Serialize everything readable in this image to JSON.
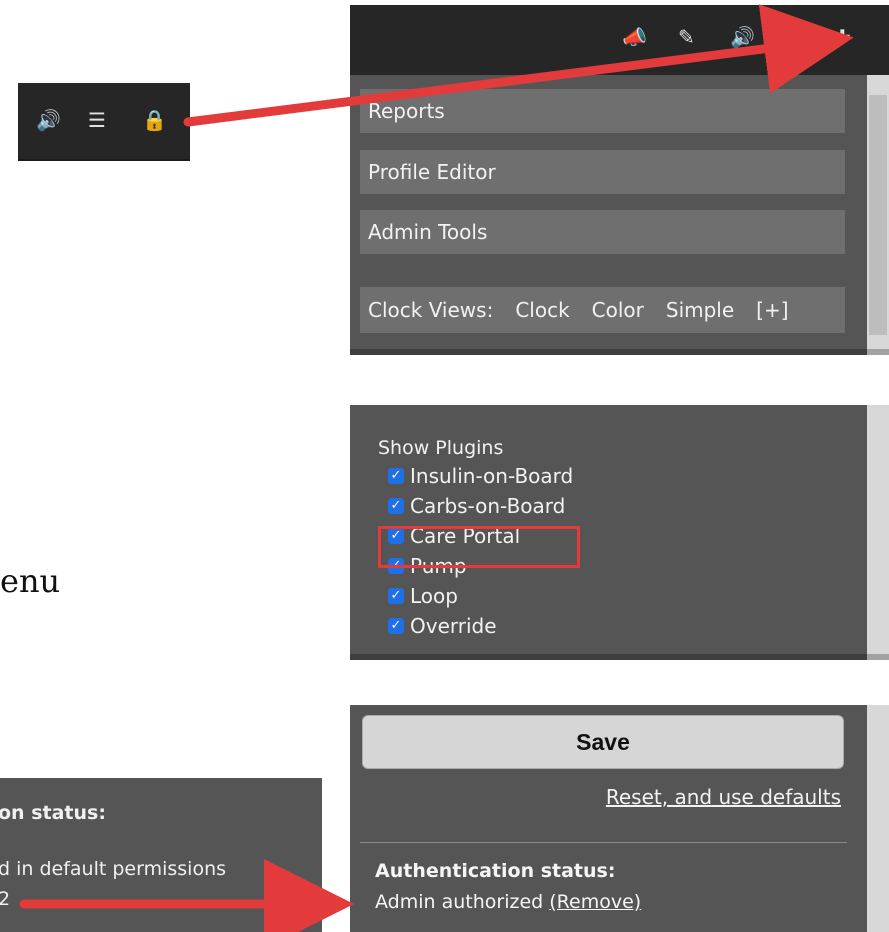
{
  "toolbar": {
    "icons": [
      "megaphone-icon",
      "edit-icon",
      "speaker-icon",
      "menu-icon",
      "plus-icon"
    ]
  },
  "menu": {
    "reports": "Reports",
    "profile_editor": "Profile Editor",
    "admin_tools": "Admin Tools"
  },
  "clock_views": {
    "label": "Clock Views:",
    "clock": "Clock",
    "color": "Color",
    "simple": "Simple",
    "more": "[+]"
  },
  "plugins": {
    "title": "Show Plugins",
    "items": [
      {
        "label": "Insulin-on-Board",
        "checked": true
      },
      {
        "label": "Carbs-on-Board",
        "checked": true
      },
      {
        "label": "Care Portal",
        "checked": true
      },
      {
        "label": "Pump",
        "checked": true
      },
      {
        "label": "Loop",
        "checked": true
      },
      {
        "label": "Override",
        "checked": true
      }
    ]
  },
  "actions": {
    "save": "Save",
    "reset": "Reset, and use defaults"
  },
  "auth": {
    "title": "Authentication status:",
    "status": "Admin authorized",
    "remove": "(Remove)"
  },
  "inset_toolbar": {
    "icons": [
      "speaker-icon",
      "menu-icon",
      "lock-icon"
    ]
  },
  "caption": {
    "menu": "enu"
  },
  "inset_auth": {
    "title": "on status:",
    "line1": "d in default permissions",
    "line2": "2"
  },
  "colors": {
    "arrow": "#e33b3b",
    "panel": "#555555",
    "toolbar": "#262626",
    "checkbox": "#1f6fe6"
  }
}
